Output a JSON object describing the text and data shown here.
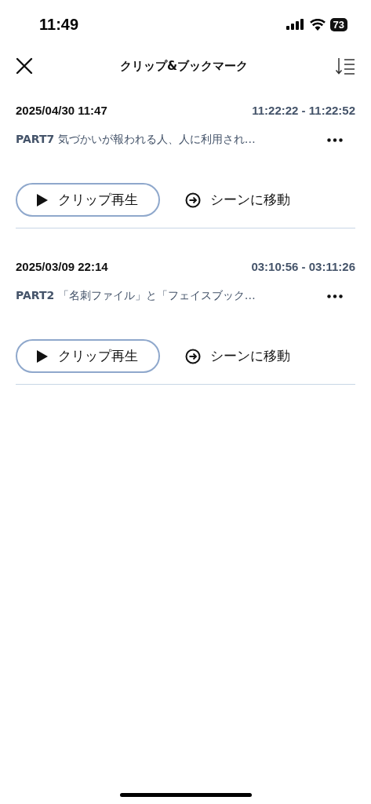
{
  "status_bar": {
    "time": "11:49",
    "battery": "73"
  },
  "header": {
    "title": "クリップ&ブックマーク"
  },
  "clips": [
    {
      "date": "2025/04/30 11:47",
      "range": "11:22:22 - 11:22:52",
      "part": "PART7",
      "title": "気づかいが報われる人、人に利用され…",
      "play_label": "クリップ再生",
      "move_label": "シーンに移動"
    },
    {
      "date": "2025/03/09 22:14",
      "range": "03:10:56 - 03:11:26",
      "part": "PART2",
      "title": "「名刺ファイル」と「フェイスブック…",
      "play_label": "クリップ再生",
      "move_label": "シーンに移動"
    }
  ]
}
